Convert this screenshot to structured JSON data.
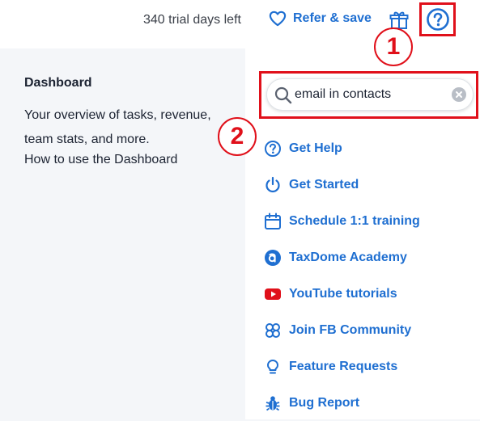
{
  "topbar": {
    "trial_text": "340 trial days left",
    "refer_label": "Refer & save"
  },
  "dashboard": {
    "title": "Dashboard",
    "description": "Your overview of tasks, revenue, team stats, and more.",
    "link": "How to use the Dashboard"
  },
  "search": {
    "value": "email in contacts"
  },
  "menu": [
    {
      "label": "Get Help",
      "icon": "question-circle-icon"
    },
    {
      "label": "Get Started",
      "icon": "power-icon"
    },
    {
      "label": "Schedule 1:1 training",
      "icon": "calendar-icon"
    },
    {
      "label": "TaxDome Academy",
      "icon": "academy-icon"
    },
    {
      "label": "YouTube tutorials",
      "icon": "youtube-icon"
    },
    {
      "label": "Join FB Community",
      "icon": "community-icon"
    },
    {
      "label": "Feature Requests",
      "icon": "lightbulb-icon"
    },
    {
      "label": "Bug Report",
      "icon": "bug-icon"
    }
  ],
  "annotations": {
    "one": "1",
    "two": "2"
  },
  "colors": {
    "accent": "#1f6fd1",
    "highlight": "#e0101a",
    "youtube": "#e0101a"
  }
}
